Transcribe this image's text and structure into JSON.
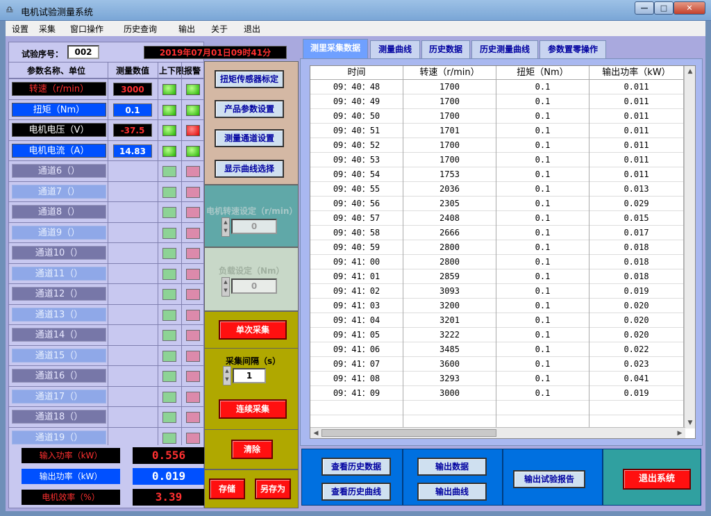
{
  "window": {
    "title": "电机试验测量系统",
    "icon": "lamp-icon"
  },
  "menu": [
    "设置",
    "采集",
    "窗口操作",
    "历史查询",
    "输出",
    "关于",
    "退出"
  ],
  "test_info": {
    "label": "试验序号：",
    "value": "002",
    "datetime": "2019年07月01日09时41分"
  },
  "table_headers": {
    "name": "参数名称、单位",
    "value": "测量数值",
    "alarm": "上下限报警"
  },
  "channels": [
    {
      "name": "转速（r/min）",
      "value": "3000",
      "style": "red",
      "val_style": "red",
      "led1": "g",
      "led2": "g"
    },
    {
      "name": "扭矩（Nm）",
      "value": "0.1",
      "style": "blue",
      "val_style": "blue",
      "led1": "g",
      "led2": "g"
    },
    {
      "name": "电机电压（V）",
      "value": "-37.5",
      "style": "dark",
      "val_style": "red",
      "led1": "g",
      "led2": "r"
    },
    {
      "name": "电机电流（A）",
      "value": "14.83",
      "style": "blue",
      "val_style": "blue",
      "led1": "g",
      "led2": "g"
    },
    {
      "name": "通道6（）",
      "value": "",
      "style": "greyd",
      "val_style": "",
      "led1": "gd",
      "led2": "rd"
    },
    {
      "name": "通道7（）",
      "value": "",
      "style": "greyl",
      "val_style": "",
      "led1": "gd",
      "led2": "rd"
    },
    {
      "name": "通道8（）",
      "value": "",
      "style": "greyd",
      "val_style": "",
      "led1": "gd",
      "led2": "rd"
    },
    {
      "name": "通道9（）",
      "value": "",
      "style": "greyl",
      "val_style": "",
      "led1": "gd",
      "led2": "rd"
    },
    {
      "name": "通道10（）",
      "value": "",
      "style": "greyd",
      "val_style": "",
      "led1": "gd",
      "led2": "rd"
    },
    {
      "name": "通道11（）",
      "value": "",
      "style": "greyl",
      "val_style": "",
      "led1": "gd",
      "led2": "rd"
    },
    {
      "name": "通道12（）",
      "value": "",
      "style": "greyd",
      "val_style": "",
      "led1": "gd",
      "led2": "rd"
    },
    {
      "name": "通道13（）",
      "value": "",
      "style": "greyl",
      "val_style": "",
      "led1": "gd",
      "led2": "rd"
    },
    {
      "name": "通道14（）",
      "value": "",
      "style": "greyd",
      "val_style": "",
      "led1": "gd",
      "led2": "rd"
    },
    {
      "name": "通道15（）",
      "value": "",
      "style": "greyl",
      "val_style": "",
      "led1": "gd",
      "led2": "rd"
    },
    {
      "name": "通道16（）",
      "value": "",
      "style": "greyd",
      "val_style": "",
      "led1": "gd",
      "led2": "rd"
    },
    {
      "name": "通道17（）",
      "value": "",
      "style": "greyl",
      "val_style": "",
      "led1": "gd",
      "led2": "rd"
    },
    {
      "name": "通道18（）",
      "value": "",
      "style": "greyd",
      "val_style": "",
      "led1": "gd",
      "led2": "rd"
    },
    {
      "name": "通道19（）",
      "value": "",
      "style": "greyl",
      "val_style": "",
      "led1": "gd",
      "led2": "rd"
    }
  ],
  "power": [
    {
      "name": "输入功率（kW）",
      "value": "0.556",
      "name_color": "#ff3030",
      "val_color": "#ff3030"
    },
    {
      "name": "输出功率（kW）",
      "value": "0.019",
      "name_color": "#ffffff",
      "val_color": "#ffffff",
      "bg": "#0050ff"
    },
    {
      "name": "电机效率（%）",
      "value": "3.39",
      "name_color": "#ff3030",
      "val_color": "#ff3030"
    }
  ],
  "mid": {
    "sensor_cal": "扭矩传感器标定",
    "product_params": "产品参数设置",
    "channel_setup": "测量通道设置",
    "curve_select": "显示曲线选择",
    "speed_label": "电机转速设定（r/min）",
    "speed_value": "0",
    "load_label": "负载设定（Nm）",
    "load_value": "0",
    "single_acq": "单次采集",
    "interval_label": "采集间隔（s）",
    "interval_value": "1",
    "continuous_acq": "连续采集",
    "clear": "清除",
    "save": "存储",
    "save_as": "另存为"
  },
  "tabs": [
    "测里采集数据",
    "测量曲线",
    "历史数据",
    "历史测量曲线",
    "参数置零操作"
  ],
  "grid": {
    "columns": [
      "时间",
      "转速（r/min）",
      "扭矩（Nm）",
      "输出功率（kW）"
    ],
    "rows": [
      [
        "09：40：48",
        "1700",
        "0.1",
        "0.011"
      ],
      [
        "09：40：49",
        "1700",
        "0.1",
        "0.011"
      ],
      [
        "09：40：50",
        "1700",
        "0.1",
        "0.011"
      ],
      [
        "09：40：51",
        "1701",
        "0.1",
        "0.011"
      ],
      [
        "09：40：52",
        "1700",
        "0.1",
        "0.011"
      ],
      [
        "09：40：53",
        "1700",
        "0.1",
        "0.011"
      ],
      [
        "09：40：54",
        "1753",
        "0.1",
        "0.011"
      ],
      [
        "09：40：55",
        "2036",
        "0.1",
        "0.013"
      ],
      [
        "09：40：56",
        "2305",
        "0.1",
        "0.029"
      ],
      [
        "09：40：57",
        "2408",
        "0.1",
        "0.015"
      ],
      [
        "09：40：58",
        "2666",
        "0.1",
        "0.017"
      ],
      [
        "09：40：59",
        "2800",
        "0.1",
        "0.018"
      ],
      [
        "09：41：00",
        "2800",
        "0.1",
        "0.018"
      ],
      [
        "09：41：01",
        "2859",
        "0.1",
        "0.018"
      ],
      [
        "09：41：02",
        "3093",
        "0.1",
        "0.019"
      ],
      [
        "09：41：03",
        "3200",
        "0.1",
        "0.020"
      ],
      [
        "09：41：04",
        "3201",
        "0.1",
        "0.020"
      ],
      [
        "09：41：05",
        "3222",
        "0.1",
        "0.020"
      ],
      [
        "09：41：06",
        "3485",
        "0.1",
        "0.022"
      ],
      [
        "09：41：07",
        "3600",
        "0.1",
        "0.023"
      ],
      [
        "09：41：08",
        "3293",
        "0.1",
        "0.041"
      ],
      [
        "09：41：09",
        "3000",
        "0.1",
        "0.019"
      ]
    ]
  },
  "bottom": {
    "view_history_data": "查看历史数据",
    "view_history_curve": "查看历史曲线",
    "export_data": "输出数据",
    "export_curve": "输出曲线",
    "export_report": "输出试验报告",
    "exit_system": "退出系统"
  }
}
